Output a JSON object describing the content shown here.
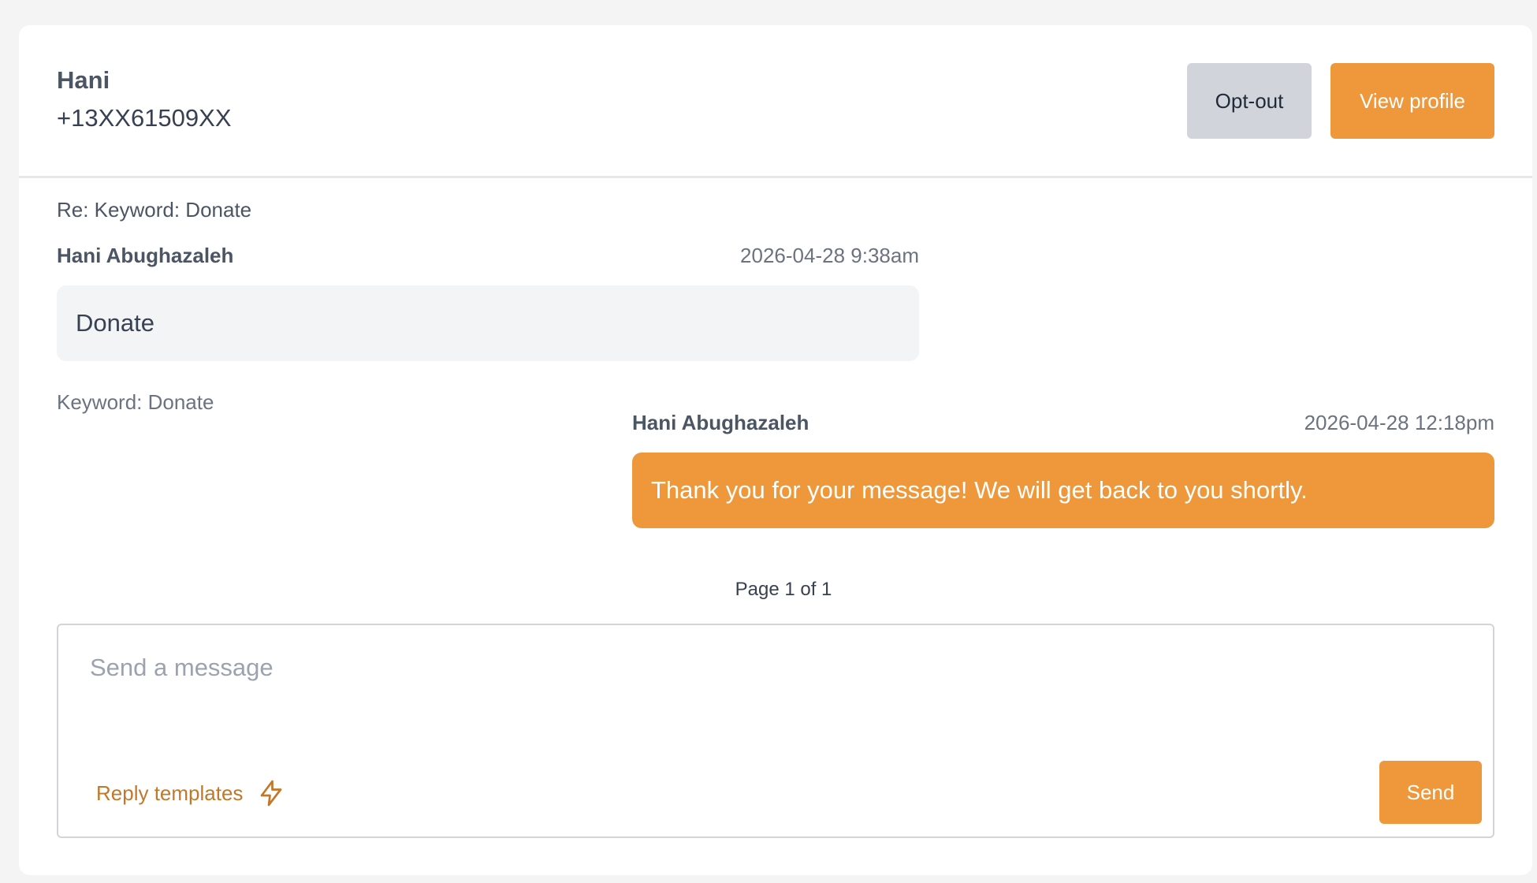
{
  "contact": {
    "name": "Hani",
    "phone": "+13XX61509XX"
  },
  "header_actions": {
    "optout_label": "Opt-out",
    "view_profile_label": "View profile"
  },
  "messages": {
    "truncated_note": "Re: Keyword: Donate",
    "items": [
      {
        "sender": "Hani Abughazaleh",
        "timestamp": "2026-04-28 9:38am",
        "body": "Donate",
        "note": "Keyword: Donate",
        "direction": "incoming"
      },
      {
        "sender": "Hani Abughazaleh",
        "timestamp": "2026-04-28 12:18pm",
        "body": "Thank you for your message! We will get back to you shortly.",
        "direction": "outgoing"
      }
    ]
  },
  "pagination": {
    "label": "Page 1 of 1"
  },
  "composer": {
    "placeholder": "Send a message",
    "reply_templates_label": "Reply templates",
    "reply_templates_icon": "lightning-bolt-icon",
    "send_label": "Send"
  },
  "colors": {
    "accent": "#ee983b",
    "accent_text": "#c2782a",
    "secondary_button": "#d1d5db",
    "incoming_bubble": "#f3f4f6"
  }
}
